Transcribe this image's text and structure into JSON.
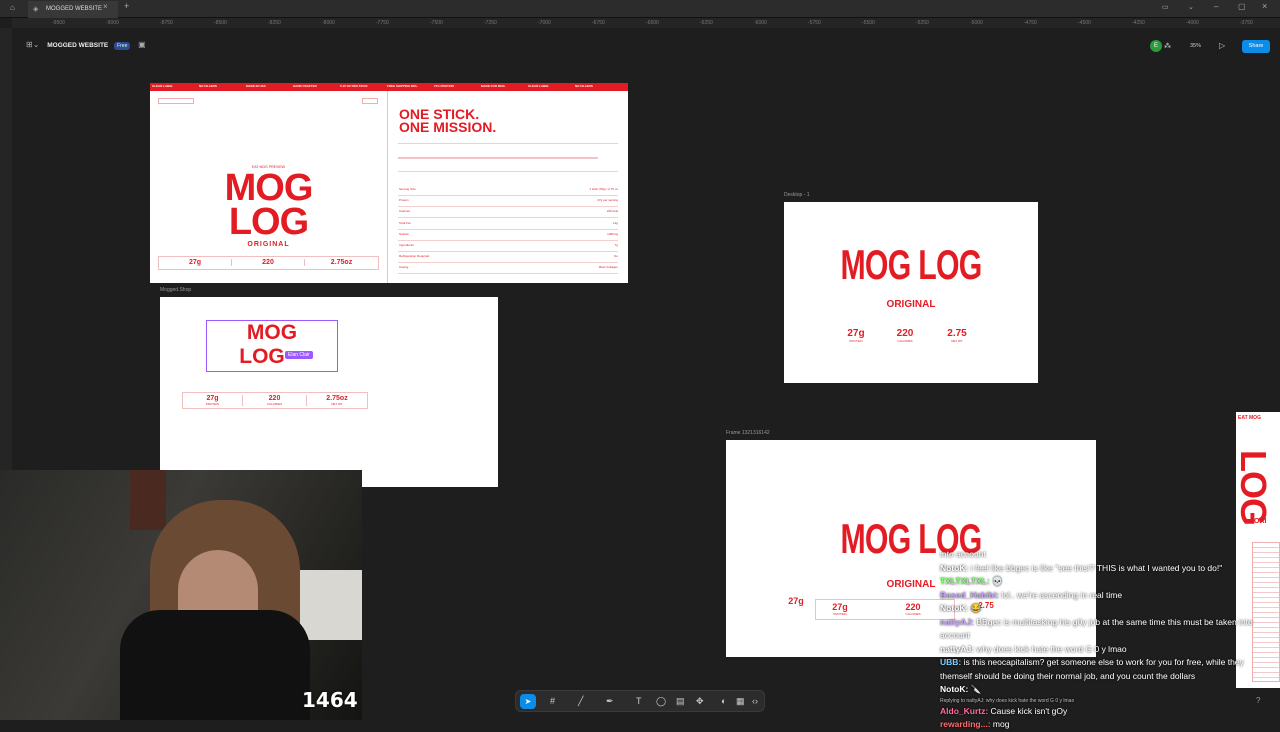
{
  "app": {
    "tab_title": "MOGGED WEBSITE",
    "file_name": "MOGGED WEBSITE",
    "plan_badge": "Free",
    "zoom": "35%",
    "share_label": "Share"
  },
  "ruler_ticks": [
    "-9500",
    "-9000",
    "-8750",
    "-8500",
    "-8250",
    "-8000",
    "-7750",
    "-7500",
    "-7250",
    "-7000",
    "-6750",
    "-6500",
    "-6250",
    "-6000",
    "-5750",
    "-5500",
    "-5250",
    "-5000",
    "-4750",
    "-4500",
    "-4250",
    "-4000",
    "-3750",
    "-3500"
  ],
  "frame1": {
    "topbar_items": [
      "CLEAN LABEL",
      "NO FILLERS",
      "MADE IN USA",
      "HAND CRAFTED",
      "5.15 OZ PER STICK",
      "FREE SHIPPING $50+",
      "27G PROTEIN",
      "MADE FOR MOG",
      "CLEAN LABEL",
      "NO FILLERS"
    ],
    "eyebrow": "EAT MOG PREVIEW",
    "logo_line1": "MOG",
    "logo_line2": "LOG",
    "sub": "ORIGINAL",
    "stats": [
      "27g",
      "220",
      "2.75oz"
    ],
    "headline1": "ONE STICK.",
    "headline2": "ONE MISSION.",
    "specs_left": [
      "Serving Size",
      "Protein",
      "Calories",
      "Total Fat",
      "Sodium",
      "Ingredients",
      "Refrigeration Required",
      "Casing"
    ],
    "specs_right": [
      "1 stick (78g) / 2.75 oz",
      "27g per serving",
      "220 kcal",
      "12g",
      "1060mg",
      "7g",
      "No",
      "Beef Collagen"
    ]
  },
  "frame2": {
    "label": "Mogged.Shop",
    "logo_line1": "MOG",
    "logo_line2": "LOG",
    "cursor_name": "Elan Clair",
    "stats": [
      "27g",
      "220",
      "2.75oz"
    ],
    "stat_labels": [
      "PROTEIN",
      "CALORIES",
      "NET WT"
    ]
  },
  "frame3": {
    "label": "Desktop - 1",
    "logo": "MOG LOG",
    "sub": "ORIGINAL",
    "stats": [
      "27g",
      "220",
      "2.75"
    ],
    "stat_labels": [
      "PROTEIN",
      "CALORIES",
      "NET WT"
    ]
  },
  "frame4": {
    "label": "Frame 1321316142",
    "logo": "MOG LOG",
    "sub": "ORIGINAL",
    "side_stat": "27g",
    "stats": [
      "27g",
      "220",
      "2.75"
    ],
    "stat_labels": [
      "PROTEIN",
      "CALORIES"
    ]
  },
  "right_frame": {
    "eyebrow": "EAT MOG",
    "logo": "LOG",
    "sub": "ORI"
  },
  "stream": {
    "viewer_count": "1464"
  },
  "chat": [
    {
      "name": "",
      "text": "into account"
    },
    {
      "name": "NotoK:",
      "text": "i feel like bbgec is like \"see this!? THIS is what I wanted you to do!\""
    },
    {
      "name": "TXLTXLTXL:",
      "text": "💀"
    },
    {
      "name": "Based_Habibi:",
      "text": "lol.. we're ascending in real time"
    },
    {
      "name": "NotoK:",
      "text": "😂"
    },
    {
      "name": "nattyAJ:",
      "text": "BBgec is multitasking his g0y job at the same time this must be taken into account"
    },
    {
      "name": "nattyAJ:",
      "text": "why does kick hate the word G 0 y lmao"
    },
    {
      "name": "UBB:",
      "text": "is this neocapitalism? get someone else to work for you for free, while they themself should be doing their normal job, and you count the dollars"
    },
    {
      "name": "NotoK:",
      "text": "🔪"
    },
    {
      "name": "",
      "text": "Replying to nattyAJ: why does kick hate the word G 0 y lmao"
    },
    {
      "name": "Aldo_Kurtz:",
      "text": "Cause kick isn't gOy"
    },
    {
      "name": "rewarding...:",
      "text": "mog"
    }
  ]
}
